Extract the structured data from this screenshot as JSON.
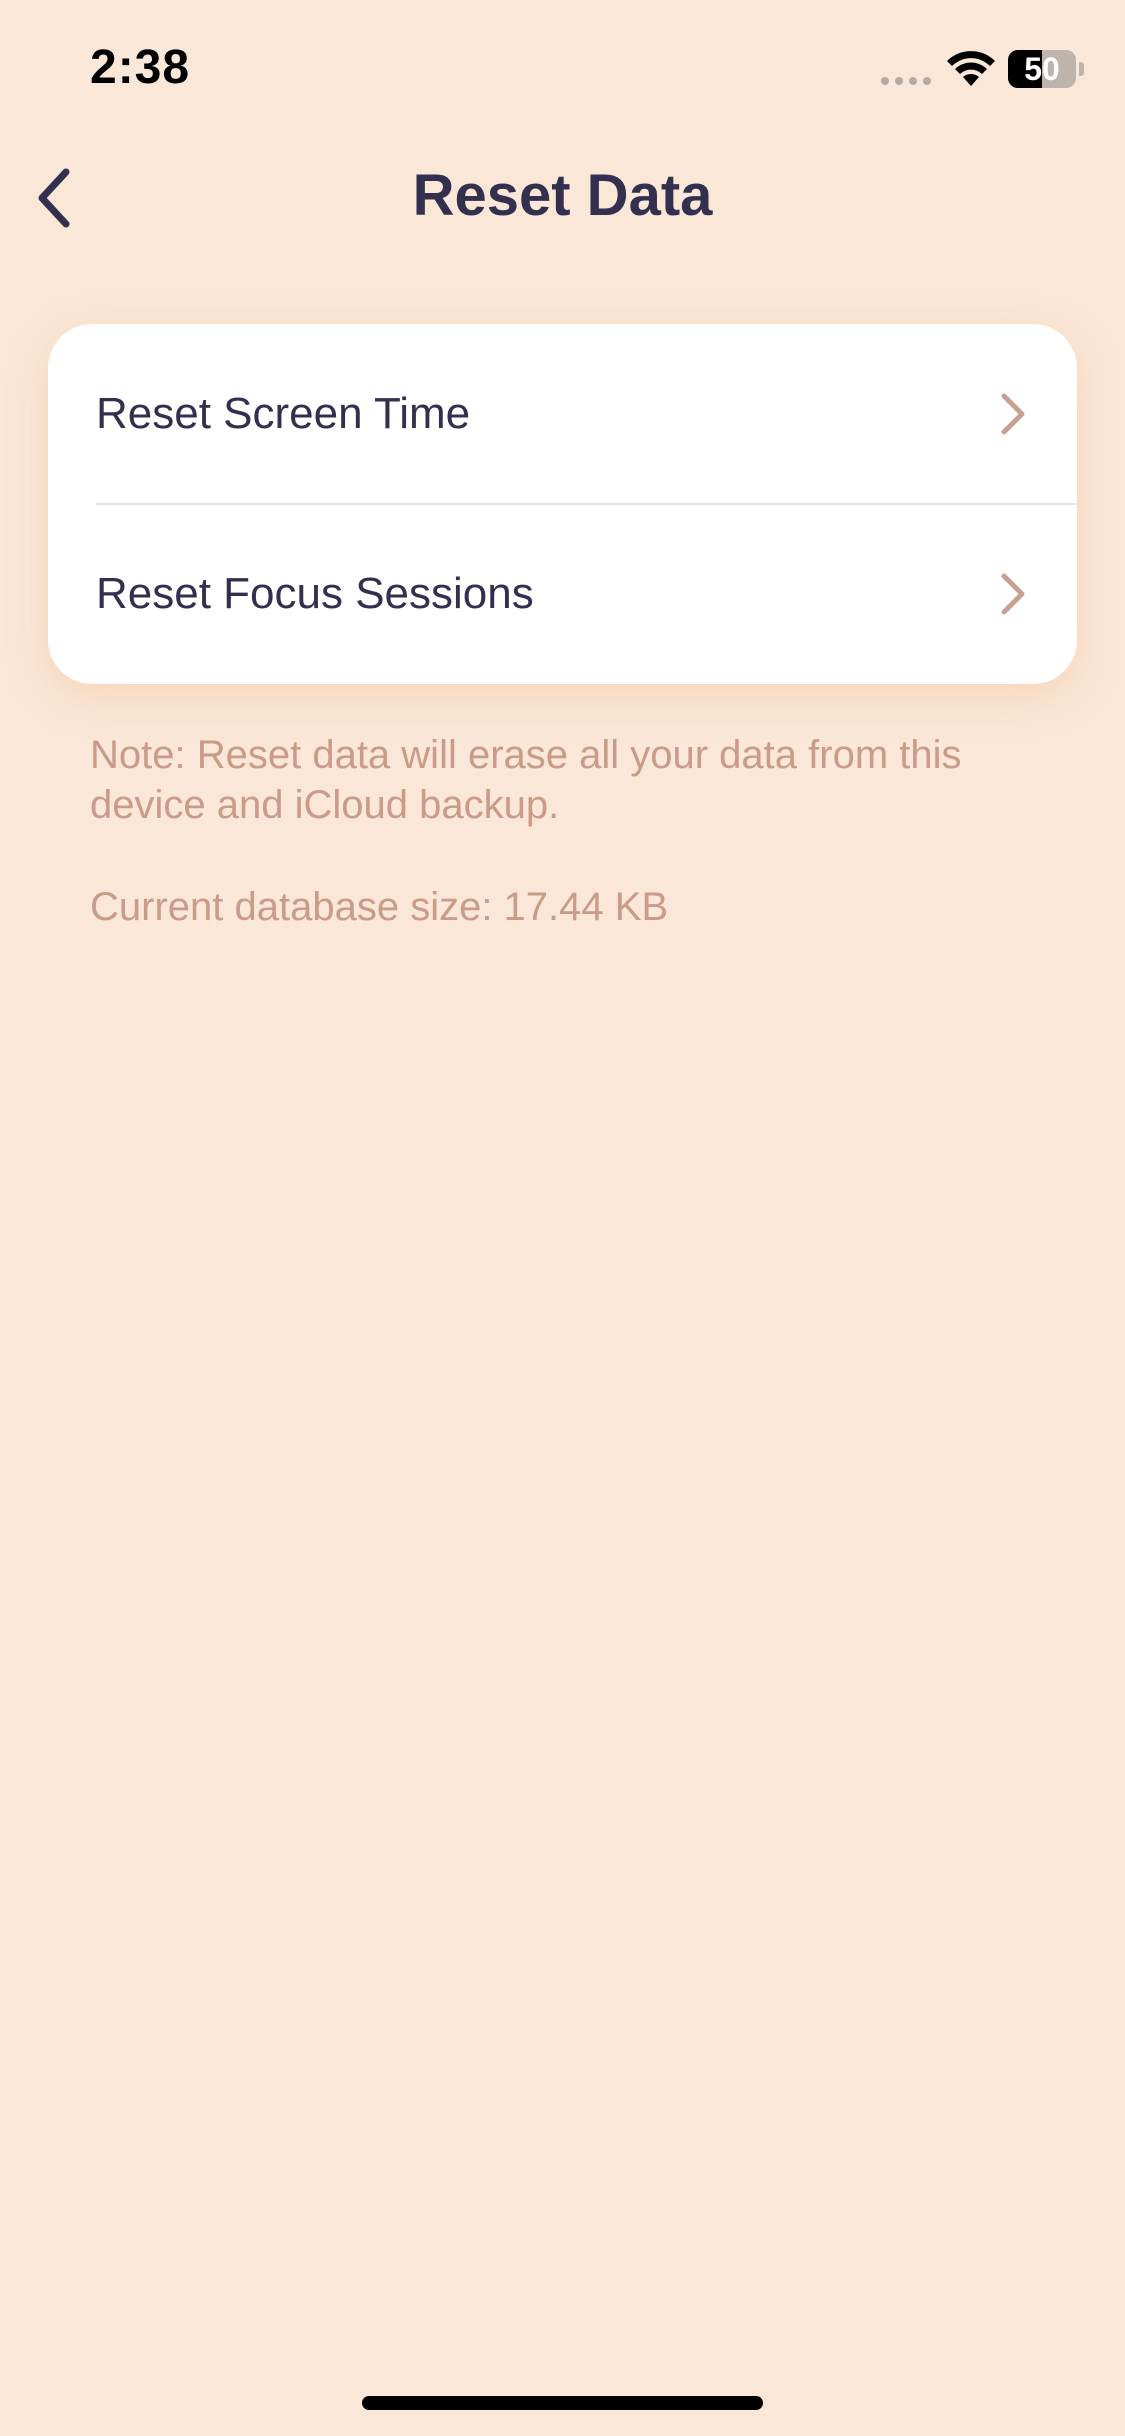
{
  "status_bar": {
    "time": "2:38",
    "battery_level": "50",
    "battery_percent": 50
  },
  "nav": {
    "title": "Reset Data",
    "back_icon": "chevron-left-icon"
  },
  "rows": [
    {
      "label": "Reset Screen Time",
      "icon": "chevron-right-icon"
    },
    {
      "label": "Reset Focus Sessions",
      "icon": "chevron-right-icon"
    }
  ],
  "footer": {
    "note": "Note: Reset data will erase all your data from this device and iCloud backup.",
    "db_size": "Current database size: 17.44 KB"
  },
  "colors": {
    "background": "#FAE7D7",
    "card": "#FFFFFF",
    "primary_text": "#33304F",
    "secondary_text": "#C99B88",
    "chevron": "#C8A090"
  }
}
